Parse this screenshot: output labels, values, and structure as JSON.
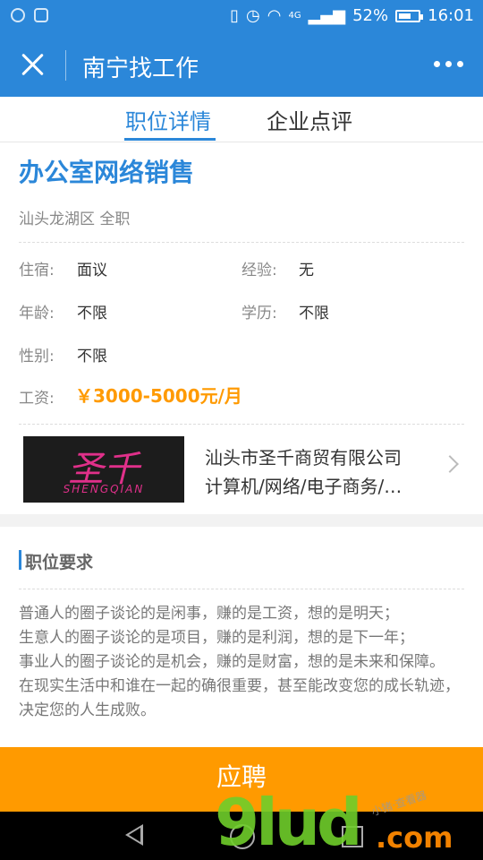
{
  "status_bar": {
    "network": "4G",
    "battery": "52%",
    "time": "16:01"
  },
  "header": {
    "title": "南宁找工作"
  },
  "tabs": [
    {
      "label": "职位详情"
    },
    {
      "label": "企业点评"
    }
  ],
  "job": {
    "title": "办公室网络销售",
    "location_type": "汕头龙湖区 全职",
    "fields": [
      {
        "label": "住宿:",
        "value": "面议"
      },
      {
        "label": "经验:",
        "value": "无"
      },
      {
        "label": "年龄:",
        "value": "不限"
      },
      {
        "label": "学历:",
        "value": "不限"
      },
      {
        "label": "性别:",
        "value": "不限"
      }
    ],
    "salary_label": "工资:",
    "salary": "￥3000-5000元/月"
  },
  "company": {
    "logo_text_cn": "圣千",
    "logo_text_en": "SHENGQIAN",
    "name": "汕头市圣千商贸有限公司",
    "industry": "计算机/网络/电子商务/…"
  },
  "requirements": {
    "title": "职位要求",
    "lines": [
      "普通人的圈子谈论的是闲事，赚的是工资，想的是明天；",
      "生意人的圈子谈论的是项目，赚的是利润，想的是下一年；",
      "事业人的圈子谈论的是机会，赚的是财富，想的是未来和保障。",
      "在现实生活中和谁在一起的确很重要，甚至能改变您的成长轨迹，决定您的人生成败。"
    ]
  },
  "apply_label": "应聘",
  "watermark": {
    "main": "9lud",
    "tld": ".com",
    "small": "小猪·查看器"
  }
}
